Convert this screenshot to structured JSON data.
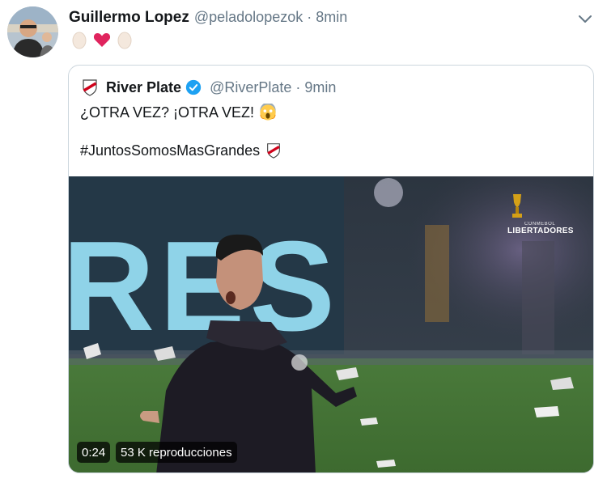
{
  "tweet": {
    "author_name": "Guillermo Lopez",
    "author_handle": "@peladolopezok",
    "separator": "·",
    "time": "8min",
    "emojis": [
      "egg-icon",
      "heart-icon",
      "egg-icon"
    ]
  },
  "quoted": {
    "author_name": "River Plate",
    "author_handle": "@RiverPlate",
    "separator": "·",
    "time": "9min",
    "verified": true,
    "text_line1": "¿OTRA VEZ? ¡OTRA VEZ!",
    "text_line2": "#JuntosSomosMasGrandes",
    "media": {
      "type": "video",
      "duration": "0:24",
      "views": "53 K reproducciones",
      "background_text": "RES",
      "overlay_logo_small": "CONMEBOL",
      "overlay_logo_big": "LIBERTADORES"
    }
  },
  "colors": {
    "text_primary": "#14171a",
    "text_secondary": "#657786",
    "border": "#ccd6dd",
    "verified_blue": "#1da1f2",
    "heart_red": "#e0245e"
  }
}
